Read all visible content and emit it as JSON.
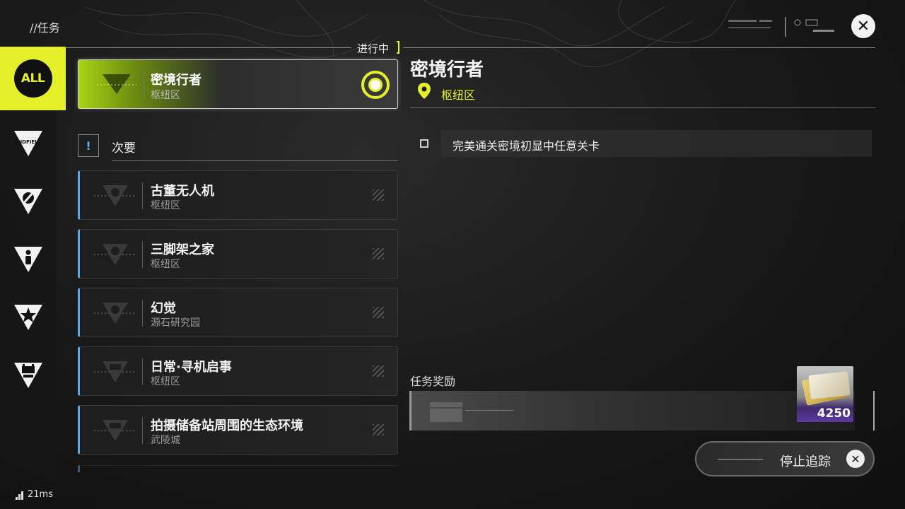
{
  "header": {
    "title": "//任务",
    "close_icon": "close-icon"
  },
  "nav": {
    "items": [
      {
        "label": "ALL",
        "icon": "all-icon",
        "active": true
      },
      {
        "label": "ENDFIELD",
        "icon": "endfield-icon",
        "active": false
      },
      {
        "icon": "wrench-triangle-icon",
        "active": false
      },
      {
        "icon": "person-triangle-icon",
        "active": false
      },
      {
        "icon": "star-triangle-icon",
        "active": false
      },
      {
        "icon": "robot-triangle-icon",
        "active": false
      }
    ]
  },
  "in_progress": {
    "label": "进行中",
    "card": {
      "title": "密境行者",
      "location": "枢纽区",
      "tracked": true
    }
  },
  "secondary": {
    "icon_text": "!",
    "label": "次要",
    "quests": [
      {
        "title": "古董无人机",
        "location": "枢纽区",
        "icon": "wrench-triangle-icon"
      },
      {
        "title": "三脚架之家",
        "location": "枢纽区",
        "icon": "wrench-triangle-icon"
      },
      {
        "title": "幻觉",
        "location": "源石研究园",
        "icon": "wrench-triangle-icon"
      },
      {
        "title": "日常·寻机启事",
        "location": "枢纽区",
        "icon": "robot-triangle-icon"
      },
      {
        "title": "拍摄储备站周围的生态环境",
        "location": "武陵城",
        "icon": "robot-triangle-icon"
      }
    ]
  },
  "detail": {
    "title": "密境行者",
    "location": "枢纽区",
    "objective": "完美通关密境初显中任意关卡"
  },
  "rewards": {
    "label": "任务奖励",
    "item_count": "4250",
    "item_icon": "currency-bills-icon"
  },
  "stop_tracking": {
    "label": "停止追踪"
  },
  "status": {
    "ping": "21ms"
  },
  "colors": {
    "accent": "#e6f02a",
    "quest_bar": "#5aa8e6"
  }
}
